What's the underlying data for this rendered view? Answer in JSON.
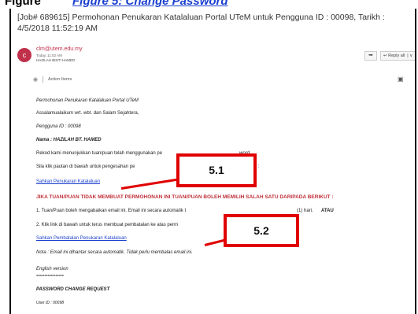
{
  "top_strip": {
    "label": "Figure",
    "link": "Figure 5: Change Password"
  },
  "email": {
    "subject": "[Job# 689615] Permohonan Penukaran Katalaluan Portal UTeM untuk Pengguna ID : 00098, Tarikh : 4/5/2018 11:52:19 AM",
    "avatar_letter": "c",
    "sender": "clm@utem.edu.my",
    "date": "Today, 11:52 AM",
    "to": "HAZILAH BINTI HAMED",
    "forward_icon": "forward-arrow",
    "reply_label": "Reply all",
    "action_items": "Action Items"
  },
  "body": {
    "title": "Permohonan Penukaran Katalaluan Portal UTeM",
    "greeting": "Assalamualaikum wrt. wbt. dan Salam Sejahtera,",
    "user_id": "Pengguna ID : 00098",
    "name": "Nama : HAZILAH BT. HAMED",
    "record": "Rekod kami menunjukkan tuan/puan telah menggunakan pe",
    "record_end": "word",
    "click_prompt": "Sila klik pautan di bawah untuk pengesahan pe",
    "click_prompt_end": "uan :",
    "confirm_link": "Sahkan Penukaran Katalaluan",
    "warning": "JIKA TUAN/PUAN TIDAK MEMBUAT PERMOHONAN INI TUAN/PUAN BOLEH MEMILIH SALAH SATU DARIPADA BERIKUT :",
    "option1": "1. Tuan/Puan boleh mengabaikan email ini. Email ini secara automatik t",
    "option1_end": "(1) hari.",
    "option1_atau": "ATAU",
    "option2": "2. Klik link di bawah untuk terus membuat pembatalan ke atas perm",
    "cancel_link": "Sahkan Pembatalan Penukaran Katalaluan",
    "note": "Nota : Email ini dihantar secara automatik. Tidak perlu membalas email ini.",
    "english": "English version",
    "separator": "==========",
    "pw_title": "PASSWORD CHANGE REQUEST",
    "user_id_en": "User ID : 00098"
  },
  "callouts": {
    "c1": "5.1",
    "c2": "5.2"
  }
}
